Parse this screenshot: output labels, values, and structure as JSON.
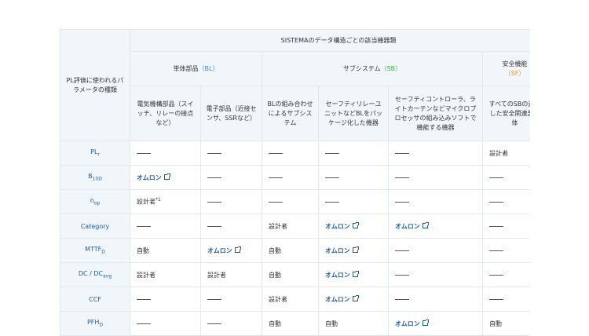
{
  "header": {
    "param_col": "PL評価に使われるパラメータの種類",
    "sistema": "SISTEMAのデータ構造ごとの該当機器類",
    "single_part": "単体部品",
    "single_tag": "（BL）",
    "subsystem": "サブシステム",
    "subsystem_tag": "（SB）",
    "safety_func": "安全機能",
    "safety_tag": "（SF）",
    "col_electromech": "電気機構部品（スイッチ、リレーの接点など）",
    "col_electronic": "電子部品（近接センサ、SSRなど）",
    "col_bl_combo": "BLの組み合わせによるサブシステム",
    "col_safety_relay": "セーフティリレーユニットなどBLをパッケージ化した機器",
    "col_controller": "セーフティコントローラ、ライトカーテンなどマイクロプロセッサの組み込みソフトで機能する機器",
    "col_all_sb": "すべてのSBの連結した安全関連部全体"
  },
  "rows": [
    {
      "param": "PL",
      "sub": "r",
      "sup": "",
      "cells": [
        "—",
        "—",
        "—",
        "—",
        "—",
        "設計者"
      ]
    },
    {
      "param": "B",
      "sub": "10D",
      "sup": "",
      "cells": [
        "オムロン",
        "—",
        "—",
        "—",
        "—",
        "—"
      ]
    },
    {
      "param": "n",
      "sub": "op",
      "sup": "",
      "cells": [
        "設計者*1",
        "—",
        "—",
        "—",
        "—",
        "—"
      ]
    },
    {
      "param": "Category",
      "sub": "",
      "sup": "",
      "cells": [
        "—",
        "—",
        "設計者",
        "オムロン",
        "オムロン",
        "—"
      ]
    },
    {
      "param": "MTTF",
      "sub": "D",
      "sup": "",
      "cells": [
        "自動",
        "オムロン",
        "自動",
        "オムロン",
        "—",
        "—"
      ]
    },
    {
      "param": "DC / DC",
      "sub": "avg",
      "sup": "",
      "cells": [
        "設計者",
        "設計者",
        "自動",
        "オムロン",
        "—",
        "—"
      ]
    },
    {
      "param": "CCF",
      "sub": "",
      "sup": "",
      "cells": [
        "—",
        "—",
        "設計者",
        "オムロン",
        "—",
        "—"
      ]
    },
    {
      "param": "PFH",
      "sub": "D",
      "sup": "",
      "cells": [
        "—",
        "—",
        "自動",
        "自動",
        "オムロン",
        "自動"
      ]
    }
  ],
  "link_value": "オムロン",
  "colors": {
    "header_bg": "#f1f6fb",
    "link": "#1d5a9c",
    "bl": "#3b8ed1",
    "sb": "#3fb24a",
    "sf": "#f19a2a"
  }
}
